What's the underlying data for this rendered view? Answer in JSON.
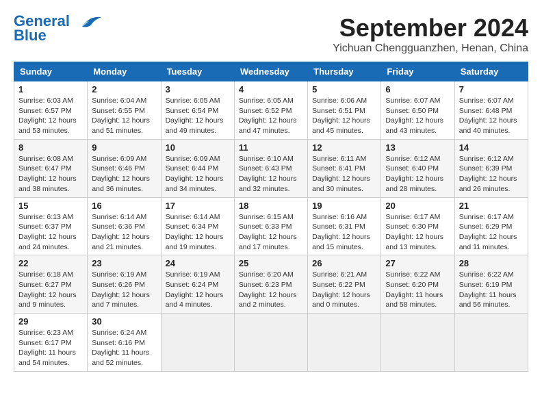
{
  "header": {
    "logo_line1": "General",
    "logo_line2": "Blue",
    "month_title": "September 2024",
    "location": "Yichuan Chengguanzhen, Henan, China"
  },
  "weekdays": [
    "Sunday",
    "Monday",
    "Tuesday",
    "Wednesday",
    "Thursday",
    "Friday",
    "Saturday"
  ],
  "weeks": [
    [
      {
        "day": "1",
        "info": "Sunrise: 6:03 AM\nSunset: 6:57 PM\nDaylight: 12 hours\nand 53 minutes."
      },
      {
        "day": "2",
        "info": "Sunrise: 6:04 AM\nSunset: 6:55 PM\nDaylight: 12 hours\nand 51 minutes."
      },
      {
        "day": "3",
        "info": "Sunrise: 6:05 AM\nSunset: 6:54 PM\nDaylight: 12 hours\nand 49 minutes."
      },
      {
        "day": "4",
        "info": "Sunrise: 6:05 AM\nSunset: 6:52 PM\nDaylight: 12 hours\nand 47 minutes."
      },
      {
        "day": "5",
        "info": "Sunrise: 6:06 AM\nSunset: 6:51 PM\nDaylight: 12 hours\nand 45 minutes."
      },
      {
        "day": "6",
        "info": "Sunrise: 6:07 AM\nSunset: 6:50 PM\nDaylight: 12 hours\nand 43 minutes."
      },
      {
        "day": "7",
        "info": "Sunrise: 6:07 AM\nSunset: 6:48 PM\nDaylight: 12 hours\nand 40 minutes."
      }
    ],
    [
      {
        "day": "8",
        "info": "Sunrise: 6:08 AM\nSunset: 6:47 PM\nDaylight: 12 hours\nand 38 minutes."
      },
      {
        "day": "9",
        "info": "Sunrise: 6:09 AM\nSunset: 6:46 PM\nDaylight: 12 hours\nand 36 minutes."
      },
      {
        "day": "10",
        "info": "Sunrise: 6:09 AM\nSunset: 6:44 PM\nDaylight: 12 hours\nand 34 minutes."
      },
      {
        "day": "11",
        "info": "Sunrise: 6:10 AM\nSunset: 6:43 PM\nDaylight: 12 hours\nand 32 minutes."
      },
      {
        "day": "12",
        "info": "Sunrise: 6:11 AM\nSunset: 6:41 PM\nDaylight: 12 hours\nand 30 minutes."
      },
      {
        "day": "13",
        "info": "Sunrise: 6:12 AM\nSunset: 6:40 PM\nDaylight: 12 hours\nand 28 minutes."
      },
      {
        "day": "14",
        "info": "Sunrise: 6:12 AM\nSunset: 6:39 PM\nDaylight: 12 hours\nand 26 minutes."
      }
    ],
    [
      {
        "day": "15",
        "info": "Sunrise: 6:13 AM\nSunset: 6:37 PM\nDaylight: 12 hours\nand 24 minutes."
      },
      {
        "day": "16",
        "info": "Sunrise: 6:14 AM\nSunset: 6:36 PM\nDaylight: 12 hours\nand 21 minutes."
      },
      {
        "day": "17",
        "info": "Sunrise: 6:14 AM\nSunset: 6:34 PM\nDaylight: 12 hours\nand 19 minutes."
      },
      {
        "day": "18",
        "info": "Sunrise: 6:15 AM\nSunset: 6:33 PM\nDaylight: 12 hours\nand 17 minutes."
      },
      {
        "day": "19",
        "info": "Sunrise: 6:16 AM\nSunset: 6:31 PM\nDaylight: 12 hours\nand 15 minutes."
      },
      {
        "day": "20",
        "info": "Sunrise: 6:17 AM\nSunset: 6:30 PM\nDaylight: 12 hours\nand 13 minutes."
      },
      {
        "day": "21",
        "info": "Sunrise: 6:17 AM\nSunset: 6:29 PM\nDaylight: 12 hours\nand 11 minutes."
      }
    ],
    [
      {
        "day": "22",
        "info": "Sunrise: 6:18 AM\nSunset: 6:27 PM\nDaylight: 12 hours\nand 9 minutes."
      },
      {
        "day": "23",
        "info": "Sunrise: 6:19 AM\nSunset: 6:26 PM\nDaylight: 12 hours\nand 7 minutes."
      },
      {
        "day": "24",
        "info": "Sunrise: 6:19 AM\nSunset: 6:24 PM\nDaylight: 12 hours\nand 4 minutes."
      },
      {
        "day": "25",
        "info": "Sunrise: 6:20 AM\nSunset: 6:23 PM\nDaylight: 12 hours\nand 2 minutes."
      },
      {
        "day": "26",
        "info": "Sunrise: 6:21 AM\nSunset: 6:22 PM\nDaylight: 12 hours\nand 0 minutes."
      },
      {
        "day": "27",
        "info": "Sunrise: 6:22 AM\nSunset: 6:20 PM\nDaylight: 11 hours\nand 58 minutes."
      },
      {
        "day": "28",
        "info": "Sunrise: 6:22 AM\nSunset: 6:19 PM\nDaylight: 11 hours\nand 56 minutes."
      }
    ],
    [
      {
        "day": "29",
        "info": "Sunrise: 6:23 AM\nSunset: 6:17 PM\nDaylight: 11 hours\nand 54 minutes."
      },
      {
        "day": "30",
        "info": "Sunrise: 6:24 AM\nSunset: 6:16 PM\nDaylight: 11 hours\nand 52 minutes."
      },
      null,
      null,
      null,
      null,
      null
    ]
  ]
}
